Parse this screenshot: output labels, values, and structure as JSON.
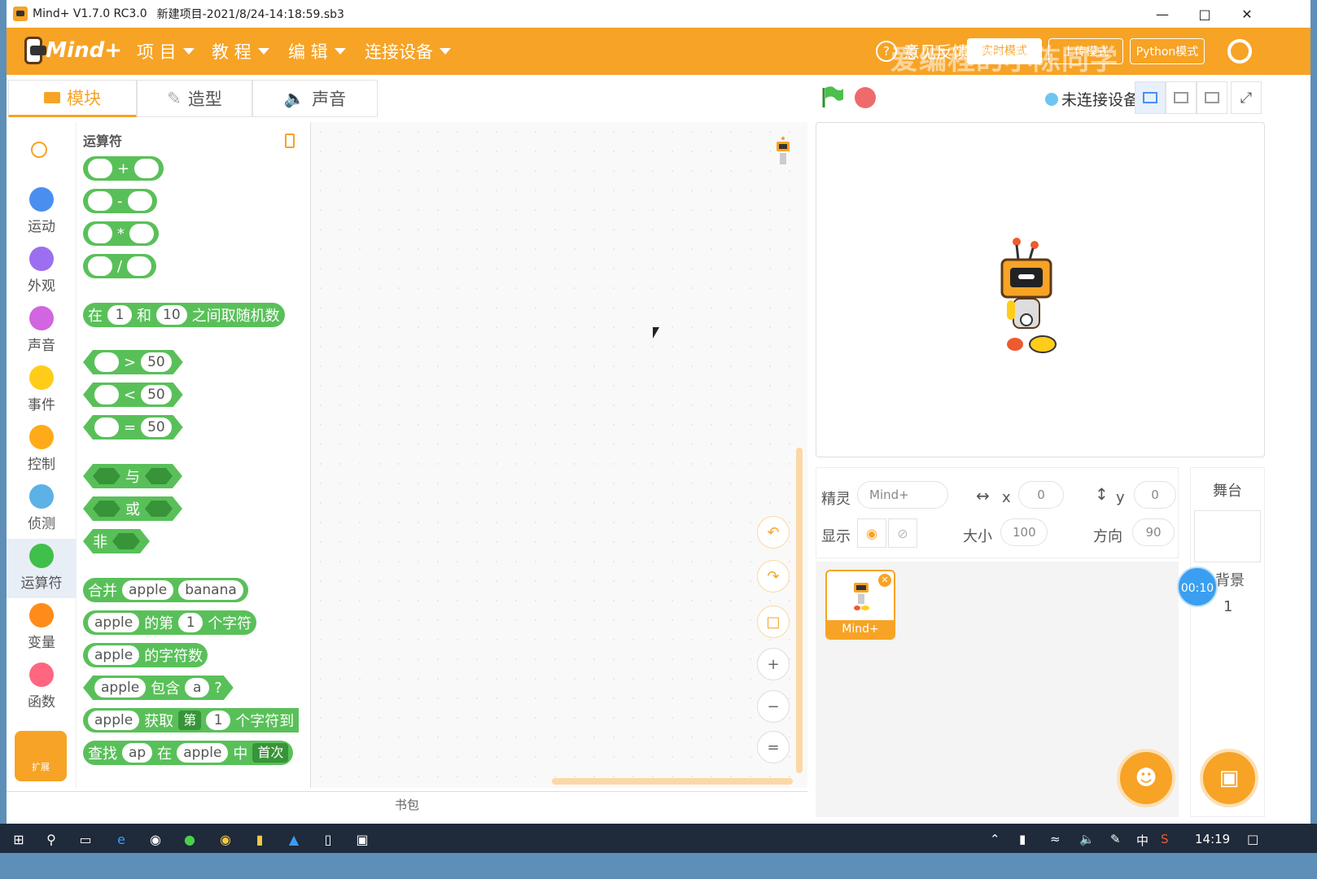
{
  "window": {
    "title": "Mind+ V1.7.0 RC3.0",
    "file": "新建项目-2021/8/24-14:18:59.sb3"
  },
  "menu": {
    "items": [
      "项 目",
      "教 程",
      "编 辑",
      "连接设备"
    ],
    "help": "意见反馈",
    "realtime": "实时模式",
    "upload": "上传模式",
    "python": "Python模式",
    "watermark": "爱编程的小陈同学"
  },
  "tabs": [
    {
      "label": "模块",
      "icon": "blocks-icon"
    },
    {
      "label": "造型",
      "icon": "brush-icon"
    },
    {
      "label": "声音",
      "icon": "speaker-icon"
    }
  ],
  "toolbar": {
    "connection": "未连接设备"
  },
  "categories": [
    {
      "label": "运动",
      "color": "#4a8ff0"
    },
    {
      "label": "外观",
      "color": "#9b6ff0"
    },
    {
      "label": "声音",
      "color": "#d265e0"
    },
    {
      "label": "事件",
      "color": "#ffcc1a"
    },
    {
      "label": "控制",
      "color": "#ffab19"
    },
    {
      "label": "侦测",
      "color": "#5cb1e6"
    },
    {
      "label": "运算符",
      "color": "#40bf4a"
    },
    {
      "label": "变量",
      "color": "#ff8c1a"
    },
    {
      "label": "函数",
      "color": "#ff6680"
    }
  ],
  "extension_label": "扩展",
  "palette": {
    "heading": "运算符",
    "ops": [
      "+",
      "-",
      "*",
      "/"
    ],
    "random": {
      "prefix": "在",
      "a": "1",
      "mid": "和",
      "b": "10",
      "suffix": "之间取随机数"
    },
    "compare": [
      {
        "op": ">",
        "v": "50"
      },
      {
        "op": "<",
        "v": "50"
      },
      {
        "op": "=",
        "v": "50"
      }
    ],
    "logic": [
      "与",
      "或",
      "非"
    ],
    "join": {
      "label": "合并",
      "a": "apple",
      "b": "banana"
    },
    "letter": {
      "a": "apple",
      "mid": "的第",
      "n": "1",
      "suffix": "个字符"
    },
    "length": {
      "a": "apple",
      "suffix": "的字符数"
    },
    "contains": {
      "a": "apple",
      "mid": "包含",
      "b": "a",
      "suffix": "?"
    },
    "substr": {
      "a": "apple",
      "mid": "获取",
      "dd": "第",
      "n": "1",
      "suffix": "个字符到"
    },
    "find": {
      "prefix": "查找",
      "a": "ap",
      "mid": "在",
      "b": "apple",
      "mid2": "中",
      "dd": "首次"
    }
  },
  "backpack": "书包",
  "sprite": {
    "label": "精灵",
    "name": "Mind+",
    "x_label": "x",
    "x": "0",
    "y_label": "y",
    "y": "0",
    "show_label": "显示",
    "size_label": "大小",
    "size": "100",
    "dir_label": "方向",
    "dir": "90",
    "thumb_name": "Mind+"
  },
  "stage_panel": {
    "title": "舞台",
    "backdrop_label": "背景",
    "backdrop_count": "1"
  },
  "timer": "00:10",
  "taskbar": {
    "ime": "中",
    "time": "14:19"
  }
}
